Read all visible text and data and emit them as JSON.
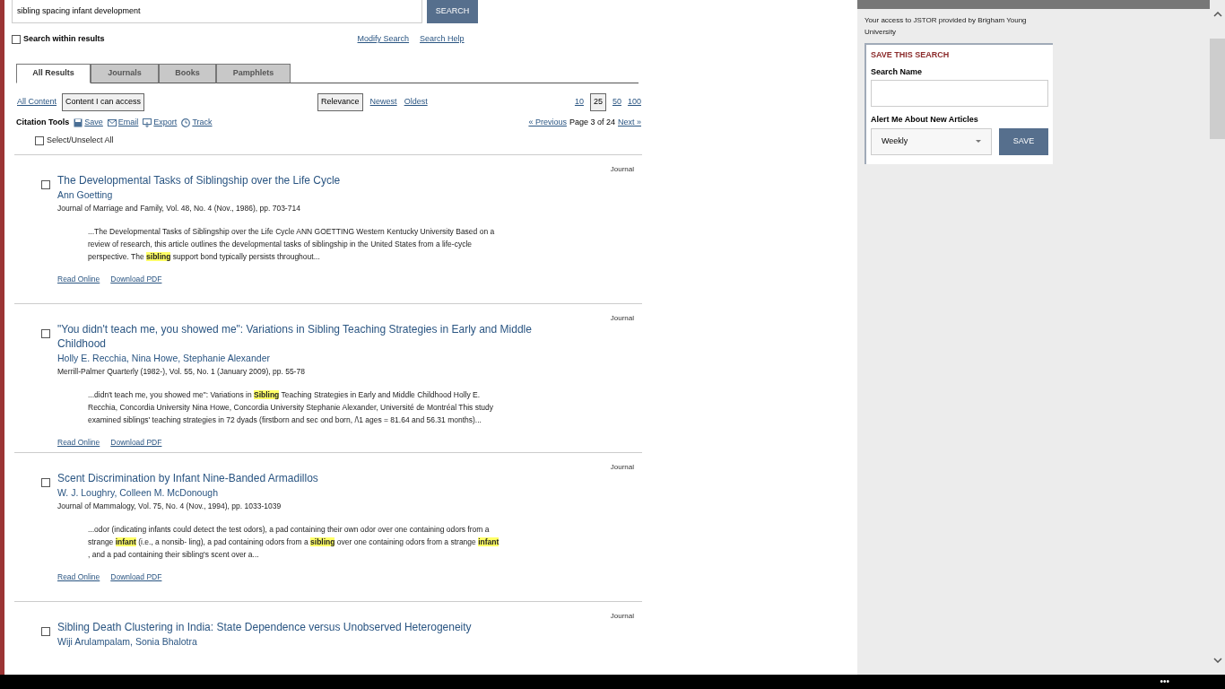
{
  "search": {
    "value": "sibling spacing infant development",
    "button": "SEARCH",
    "within": {
      "label": "Search within results",
      "checked": false
    },
    "links": [
      "Modify Search",
      "Search Help"
    ]
  },
  "tabs": [
    {
      "label": "All Results",
      "selected": true
    },
    {
      "label": "Journals",
      "selected": false
    },
    {
      "label": "Books",
      "selected": false
    },
    {
      "label": "Pamphlets",
      "selected": false
    }
  ],
  "content_filter": [
    {
      "label": "All Content",
      "selected": false
    },
    {
      "label": "Content I can access",
      "selected": true
    }
  ],
  "sort": [
    {
      "label": "Relevance",
      "selected": true
    },
    {
      "label": "Newest",
      "selected": false
    },
    {
      "label": "Oldest",
      "selected": false
    }
  ],
  "per_page": [
    {
      "label": "10",
      "selected": false
    },
    {
      "label": "25",
      "selected": true
    },
    {
      "label": "50",
      "selected": false
    },
    {
      "label": "100",
      "selected": false
    }
  ],
  "citation_tools": {
    "label": "Citation Tools",
    "items": [
      {
        "kind": "save",
        "label": "Save"
      },
      {
        "kind": "email",
        "label": "Email"
      },
      {
        "kind": "export",
        "label": "Export"
      },
      {
        "kind": "track",
        "label": "Track"
      }
    ]
  },
  "pagination": {
    "previous": "« Previous",
    "status": "Page 3 of 24",
    "next": "Next »"
  },
  "select_all": {
    "label": "Select/Unselect All",
    "checked": false
  },
  "results": [
    {
      "checked": false,
      "type": "Journal",
      "title": "The Developmental Tasks of Siblingship over the Life Cycle",
      "authors": "Ann Goetting",
      "citation": "Journal of Marriage and Family, Vol. 48, No. 4 (Nov., 1986), pp. 703-714",
      "snippet": "...The Developmental Tasks of Siblingship over the Life Cycle ANN GOETTING Western Kentucky University Based on a review of research, this article outlines the developmental tasks of siblingship in the United States from a life-cycle perspective. The **sibling** support bond typically persists throughout...",
      "links": [
        "Read Online",
        "Download PDF"
      ]
    },
    {
      "checked": false,
      "type": "Journal",
      "title": "\"You didn't teach me, you showed me\": Variations in Sibling Teaching Strategies in Early and Middle Childhood",
      "authors": "Holly E. Recchia, Nina Howe, Stephanie Alexander",
      "citation": "Merrill-Palmer Quarterly (1982-), Vol. 55, No. 1 (January 2009), pp. 55-78",
      "snippet": "...didn't teach me, you showed me\": Variations in **Sibling** Teaching Strategies in Early and Middle Childhood Holly E. Recchia, Concordia University Nina Howe, Concordia University Stephanie Alexander, Université de Montréal This study examined siblings' teaching strategies in 72 dyads (firstborn and sec ond born, /\\1 ages = 81.64 and 56.31 months)...",
      "links": [
        "Read Online",
        "Download PDF"
      ]
    },
    {
      "checked": false,
      "type": "Journal",
      "title": "Scent Discrimination by Infant Nine-Banded Armadillos",
      "authors": "W. J. Loughry, Colleen M. McDonough",
      "citation": "Journal of Mammalogy, Vol. 75, No. 4 (Nov., 1994), pp. 1033-1039",
      "snippet": "...odor (indicating infants could detect the test odors), a pad containing their own odor over one containing odors from a strange **infant** (i.e., a nonsib- ling), a pad containing odors from a **sibling** over one containing odors from a strange **infant** , and a pad containing their sibling's scent over a...",
      "links": [
        "Read Online",
        "Download PDF"
      ]
    },
    {
      "checked": false,
      "type": "Journal",
      "title": "Sibling Death Clustering in India: State Dependence versus Unobserved Heterogeneity",
      "authors": "Wiji Arulampalam, Sonia Bhalotra"
    }
  ],
  "sidebar": {
    "access_note": "Your access to JSTOR provided by Brigham Young University",
    "save_search": {
      "heading": "SAVE THIS SEARCH",
      "name_label": "Search Name",
      "alert_label": "Alert Me About New Articles",
      "frequency": "Weekly",
      "button": "SAVE"
    }
  },
  "taskbar": {
    "more": "•••"
  }
}
